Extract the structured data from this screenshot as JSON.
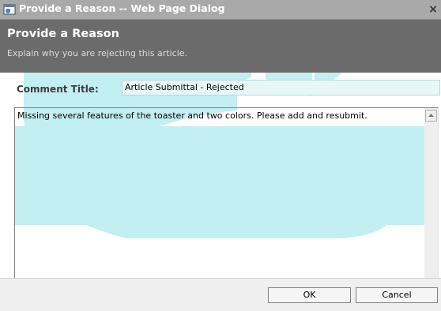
{
  "window": {
    "title": "Provide a Reason -- Web Page Dialog",
    "close_glyph": "×"
  },
  "header": {
    "title": "Provide a Reason",
    "subtitle": "Explain why you are rejecting this article."
  },
  "form": {
    "comment_title_label": "Comment Title:",
    "comment_title_value": "Article Submittal - Rejected",
    "comment_body": "Missing several features of the toaster and two colors. Please add and resubmit."
  },
  "buttons": {
    "ok_label": "OK",
    "cancel_label": "Cancel"
  },
  "colors": {
    "watermark": "#c3eef2",
    "header_band": "#6b6b6b",
    "input_bg": "#e7f7f7"
  },
  "icons": {
    "title_icon": "web-page-dialog-icon",
    "scroll_up": "scroll-up-arrow-icon",
    "scroll_down": "scroll-down-arrow-icon"
  }
}
